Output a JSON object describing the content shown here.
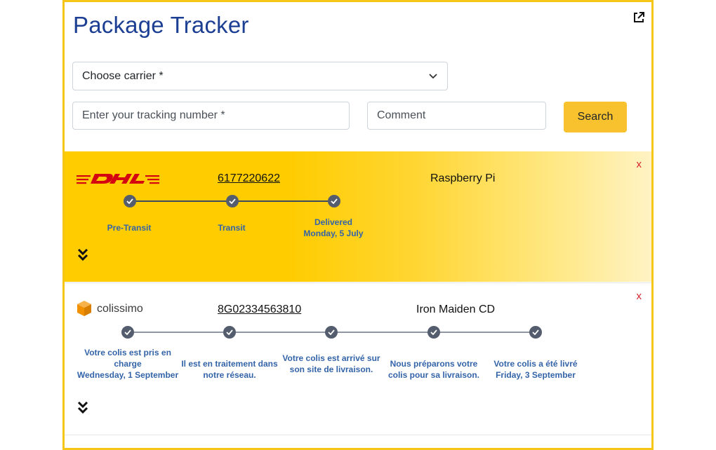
{
  "app": {
    "title": "Package Tracker"
  },
  "form": {
    "carrier_select": "Choose carrier *",
    "tracking_placeholder": "Enter your tracking number *",
    "comment_placeholder": "Comment",
    "search_label": "Search"
  },
  "packages": [
    {
      "carrier": "DHL",
      "tracking_number": "6177220622",
      "item": "Raspberry Pi",
      "close": "x",
      "steps": [
        {
          "label": "Pre-Transit"
        },
        {
          "label": "Transit"
        },
        {
          "label": "Delivered\nMonday, 5 July"
        }
      ]
    },
    {
      "carrier": "colissimo",
      "tracking_number": "8G02334563810",
      "item": "Iron Maiden CD",
      "close": "x",
      "steps": [
        {
          "label": "Votre colis est pris en charge\nWednesday, 1 September"
        },
        {
          "label": "Il est en traitement dans notre réseau."
        },
        {
          "label": "Votre colis est arrivé sur son site de livraison."
        },
        {
          "label": "Nous préparons votre colis pour sa livraison."
        },
        {
          "label": "Votre colis a été livré\nFriday, 3 September"
        }
      ]
    }
  ],
  "colors": {
    "title": "#1c3f94",
    "accent": "#f8c22f",
    "dhl_yellow": "#ffcc00",
    "dhl_red": "#d40511",
    "colissimo_orange": "#f29100",
    "close_red": "#d9232d",
    "step_label": "#3464a8"
  },
  "icons": {
    "external": "external-link-icon",
    "dropdown": "chevron-down-icon",
    "check": "check-icon",
    "expand": "double-chevron-down-icon"
  }
}
